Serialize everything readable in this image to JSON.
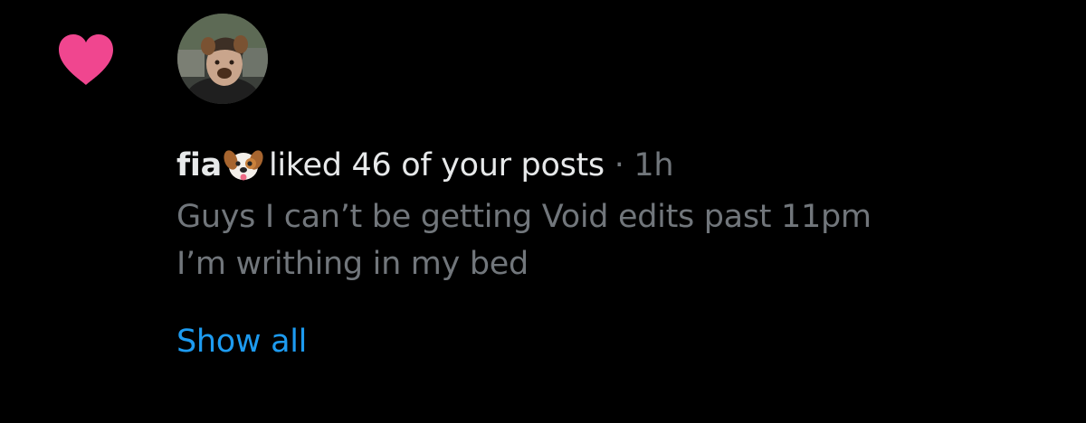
{
  "notification": {
    "type_icon": "heart-icon",
    "heart_color": "#f91880",
    "avatar_icon": "user-avatar",
    "user_name": "fia",
    "name_emoji": "dog-face-emoji",
    "action_text": "liked 46 of your posts",
    "separator": "·",
    "timestamp": "1h",
    "post_line_1": "Guys I can’t be getting Void edits past 11pm",
    "post_line_2": "I’m writhing in my bed",
    "show_all_label": "Show all",
    "link_color": "#1d9bf0",
    "muted_color": "#71767b"
  }
}
